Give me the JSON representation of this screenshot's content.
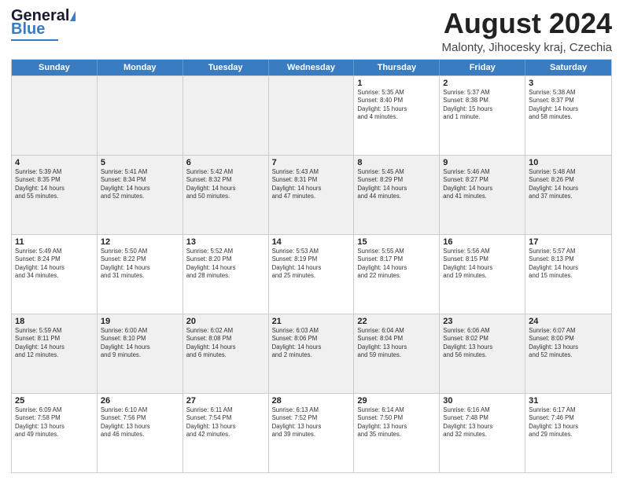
{
  "logo": {
    "text1": "General",
    "text2": "Blue"
  },
  "title": "August 2024",
  "location": "Malonty, Jihocesky kraj, Czechia",
  "days_of_week": [
    "Sunday",
    "Monday",
    "Tuesday",
    "Wednesday",
    "Thursday",
    "Friday",
    "Saturday"
  ],
  "rows": [
    [
      {
        "day": "",
        "info": "",
        "shaded": true
      },
      {
        "day": "",
        "info": "",
        "shaded": true
      },
      {
        "day": "",
        "info": "",
        "shaded": true
      },
      {
        "day": "",
        "info": "",
        "shaded": true
      },
      {
        "day": "1",
        "info": "Sunrise: 5:35 AM\nSunset: 8:40 PM\nDaylight: 15 hours\nand 4 minutes.",
        "shaded": false
      },
      {
        "day": "2",
        "info": "Sunrise: 5:37 AM\nSunset: 8:38 PM\nDaylight: 15 hours\nand 1 minute.",
        "shaded": false
      },
      {
        "day": "3",
        "info": "Sunrise: 5:38 AM\nSunset: 8:37 PM\nDaylight: 14 hours\nand 58 minutes.",
        "shaded": false
      }
    ],
    [
      {
        "day": "4",
        "info": "Sunrise: 5:39 AM\nSunset: 8:35 PM\nDaylight: 14 hours\nand 55 minutes.",
        "shaded": true
      },
      {
        "day": "5",
        "info": "Sunrise: 5:41 AM\nSunset: 8:34 PM\nDaylight: 14 hours\nand 52 minutes.",
        "shaded": true
      },
      {
        "day": "6",
        "info": "Sunrise: 5:42 AM\nSunset: 8:32 PM\nDaylight: 14 hours\nand 50 minutes.",
        "shaded": true
      },
      {
        "day": "7",
        "info": "Sunrise: 5:43 AM\nSunset: 8:31 PM\nDaylight: 14 hours\nand 47 minutes.",
        "shaded": true
      },
      {
        "day": "8",
        "info": "Sunrise: 5:45 AM\nSunset: 8:29 PM\nDaylight: 14 hours\nand 44 minutes.",
        "shaded": true
      },
      {
        "day": "9",
        "info": "Sunrise: 5:46 AM\nSunset: 8:27 PM\nDaylight: 14 hours\nand 41 minutes.",
        "shaded": true
      },
      {
        "day": "10",
        "info": "Sunrise: 5:48 AM\nSunset: 8:26 PM\nDaylight: 14 hours\nand 37 minutes.",
        "shaded": true
      }
    ],
    [
      {
        "day": "11",
        "info": "Sunrise: 5:49 AM\nSunset: 8:24 PM\nDaylight: 14 hours\nand 34 minutes.",
        "shaded": false
      },
      {
        "day": "12",
        "info": "Sunrise: 5:50 AM\nSunset: 8:22 PM\nDaylight: 14 hours\nand 31 minutes.",
        "shaded": false
      },
      {
        "day": "13",
        "info": "Sunrise: 5:52 AM\nSunset: 8:20 PM\nDaylight: 14 hours\nand 28 minutes.",
        "shaded": false
      },
      {
        "day": "14",
        "info": "Sunrise: 5:53 AM\nSunset: 8:19 PM\nDaylight: 14 hours\nand 25 minutes.",
        "shaded": false
      },
      {
        "day": "15",
        "info": "Sunrise: 5:55 AM\nSunset: 8:17 PM\nDaylight: 14 hours\nand 22 minutes.",
        "shaded": false
      },
      {
        "day": "16",
        "info": "Sunrise: 5:56 AM\nSunset: 8:15 PM\nDaylight: 14 hours\nand 19 minutes.",
        "shaded": false
      },
      {
        "day": "17",
        "info": "Sunrise: 5:57 AM\nSunset: 8:13 PM\nDaylight: 14 hours\nand 15 minutes.",
        "shaded": false
      }
    ],
    [
      {
        "day": "18",
        "info": "Sunrise: 5:59 AM\nSunset: 8:11 PM\nDaylight: 14 hours\nand 12 minutes.",
        "shaded": true
      },
      {
        "day": "19",
        "info": "Sunrise: 6:00 AM\nSunset: 8:10 PM\nDaylight: 14 hours\nand 9 minutes.",
        "shaded": true
      },
      {
        "day": "20",
        "info": "Sunrise: 6:02 AM\nSunset: 8:08 PM\nDaylight: 14 hours\nand 6 minutes.",
        "shaded": true
      },
      {
        "day": "21",
        "info": "Sunrise: 6:03 AM\nSunset: 8:06 PM\nDaylight: 14 hours\nand 2 minutes.",
        "shaded": true
      },
      {
        "day": "22",
        "info": "Sunrise: 6:04 AM\nSunset: 8:04 PM\nDaylight: 13 hours\nand 59 minutes.",
        "shaded": true
      },
      {
        "day": "23",
        "info": "Sunrise: 6:06 AM\nSunset: 8:02 PM\nDaylight: 13 hours\nand 56 minutes.",
        "shaded": true
      },
      {
        "day": "24",
        "info": "Sunrise: 6:07 AM\nSunset: 8:00 PM\nDaylight: 13 hours\nand 52 minutes.",
        "shaded": true
      }
    ],
    [
      {
        "day": "25",
        "info": "Sunrise: 6:09 AM\nSunset: 7:58 PM\nDaylight: 13 hours\nand 49 minutes.",
        "shaded": false
      },
      {
        "day": "26",
        "info": "Sunrise: 6:10 AM\nSunset: 7:56 PM\nDaylight: 13 hours\nand 46 minutes.",
        "shaded": false
      },
      {
        "day": "27",
        "info": "Sunrise: 6:11 AM\nSunset: 7:54 PM\nDaylight: 13 hours\nand 42 minutes.",
        "shaded": false
      },
      {
        "day": "28",
        "info": "Sunrise: 6:13 AM\nSunset: 7:52 PM\nDaylight: 13 hours\nand 39 minutes.",
        "shaded": false
      },
      {
        "day": "29",
        "info": "Sunrise: 6:14 AM\nSunset: 7:50 PM\nDaylight: 13 hours\nand 35 minutes.",
        "shaded": false
      },
      {
        "day": "30",
        "info": "Sunrise: 6:16 AM\nSunset: 7:48 PM\nDaylight: 13 hours\nand 32 minutes.",
        "shaded": false
      },
      {
        "day": "31",
        "info": "Sunrise: 6:17 AM\nSunset: 7:46 PM\nDaylight: 13 hours\nand 29 minutes.",
        "shaded": false
      }
    ]
  ]
}
